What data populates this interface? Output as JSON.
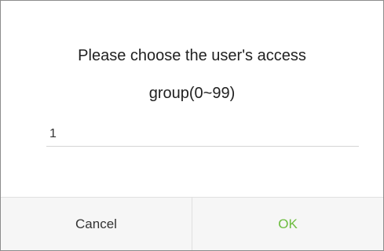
{
  "dialog": {
    "prompt_line1": "Please choose the user's access",
    "prompt_line2": "group(0~99)",
    "input_value": "1",
    "cancel_label": "Cancel",
    "ok_label": "OK",
    "ok_color": "#6cbc3e"
  }
}
